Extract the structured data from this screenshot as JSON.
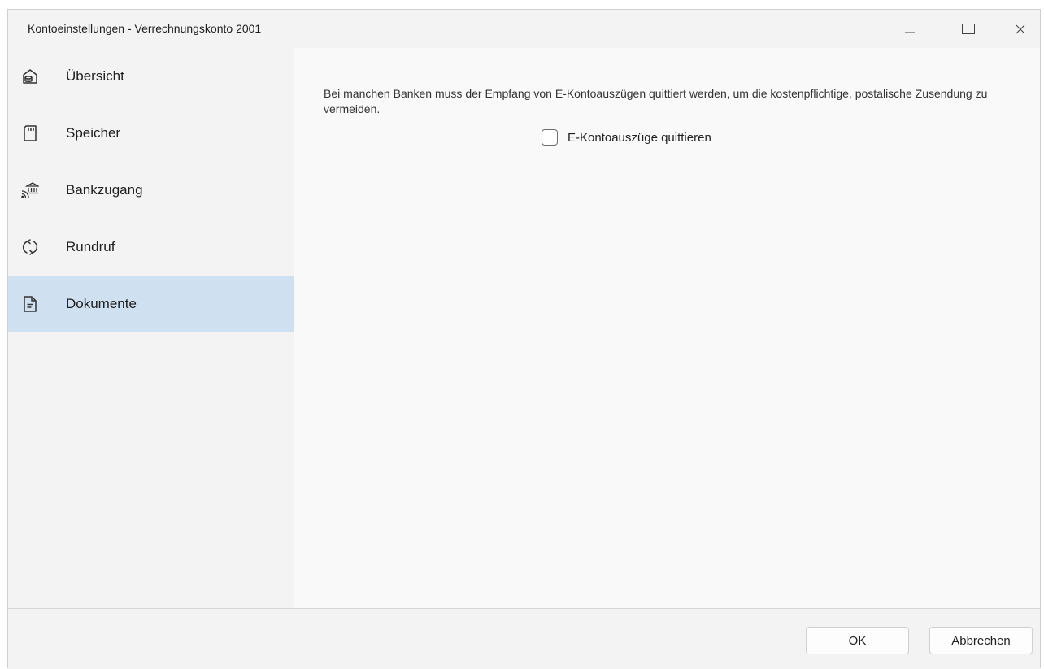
{
  "window": {
    "title": "Kontoeinstellungen - Verrechnungskonto 2001",
    "controls": [
      "minimize",
      "maximize",
      "close"
    ]
  },
  "sidebar": {
    "items": [
      {
        "label": "Übersicht",
        "icon": "overview-icon",
        "active": false
      },
      {
        "label": "Speicher",
        "icon": "memory-card-icon",
        "active": false
      },
      {
        "label": "Bankzugang",
        "icon": "bank-icon",
        "active": false
      },
      {
        "label": "Rundruf",
        "icon": "refresh-icon",
        "active": false
      },
      {
        "label": "Dokumente",
        "icon": "document-icon",
        "active": true
      }
    ]
  },
  "main": {
    "description": "Bei manchen Banken muss der Empfang von E-Kontoauszügen quittiert werden, um die kostenpflichtige, postalische Zusendung zu vermeiden.",
    "checkbox": {
      "label": "E-Kontoauszüge quittieren",
      "checked": false
    }
  },
  "footer": {
    "ok_label": "OK",
    "cancel_label": "Abbrechen"
  },
  "colors": {
    "active_item": "#cfe0f1",
    "sidebar_bg": "#f3f3f3",
    "content_bg": "#f9f9f9"
  }
}
